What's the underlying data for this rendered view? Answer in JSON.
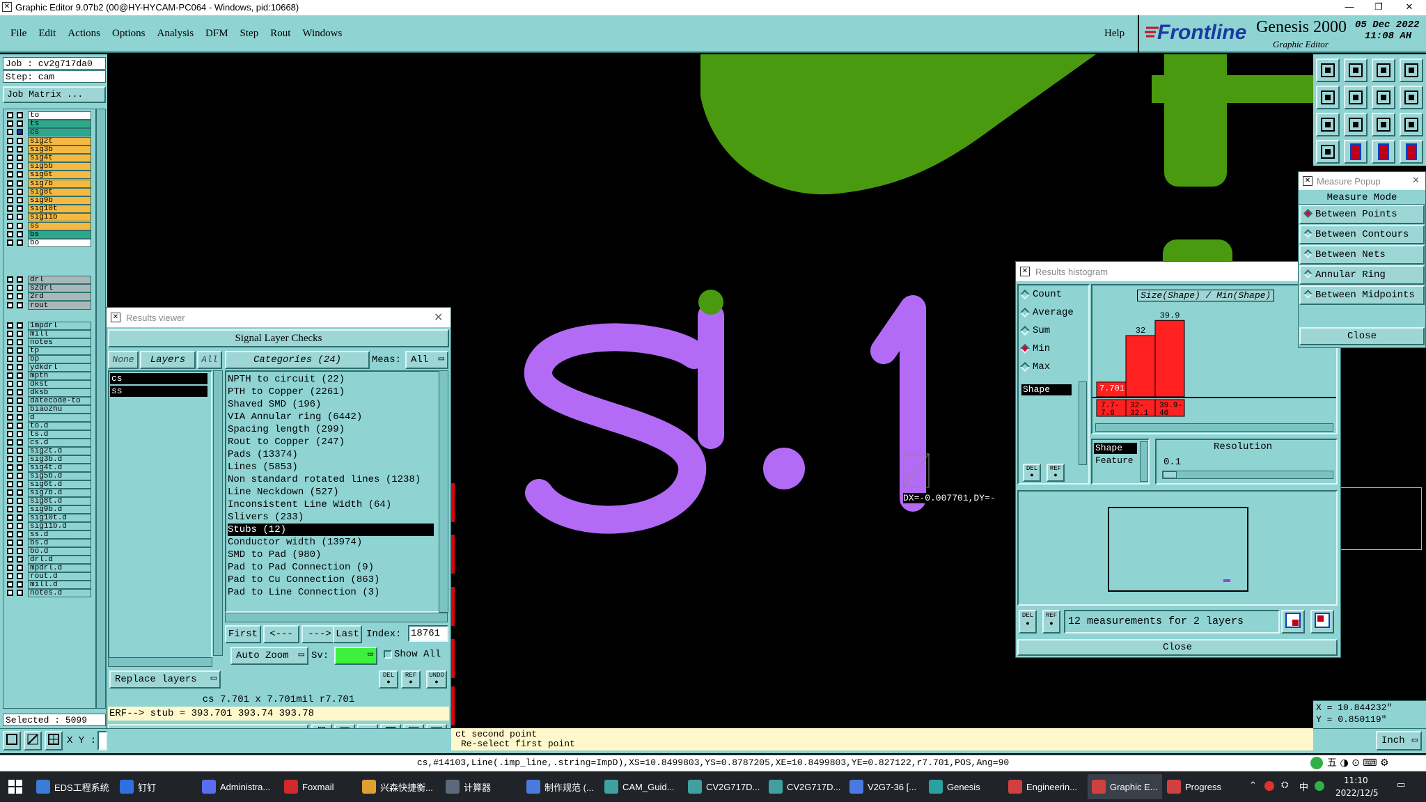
{
  "window": {
    "title": "Graphic Editor 9.07b2 (00@HY-HYCAM-PC064 - Windows, pid:10668)"
  },
  "menu": [
    "File",
    "Edit",
    "Actions",
    "Options",
    "Analysis",
    "DFM",
    "Step",
    "Rout",
    "Windows"
  ],
  "help": "Help",
  "brand": {
    "logo": "Frontline",
    "product": "Genesis 2000",
    "sub": "Graphic Editor",
    "date": "05 Dec 2022",
    "time": "11:08 AH"
  },
  "job": {
    "job": "Job : cv2g717da0",
    "step": "Step: cam",
    "matrix": "Job Matrix ..."
  },
  "layers_top": [
    {
      "name": "to",
      "color": "#ffffff"
    },
    {
      "name": "ts",
      "color": "#2ea88a"
    },
    {
      "name": "cs",
      "color": "#2ea88a",
      "active": true
    },
    {
      "name": "sig2t",
      "color": "#f5b942"
    },
    {
      "name": "sig3b",
      "color": "#f5b942"
    },
    {
      "name": "sig4t",
      "color": "#f5b942"
    },
    {
      "name": "sig5b",
      "color": "#f5b942"
    },
    {
      "name": "sig6t",
      "color": "#f5b942"
    },
    {
      "name": "sig7b",
      "color": "#f5b942"
    },
    {
      "name": "sig8t",
      "color": "#f5b942"
    },
    {
      "name": "sig9b",
      "color": "#f5b942"
    },
    {
      "name": "sig10t",
      "color": "#f5b942"
    },
    {
      "name": "sig11b",
      "color": "#f5b942"
    },
    {
      "name": "ss",
      "color": "#f5b942"
    },
    {
      "name": "bs",
      "color": "#2ea88a"
    },
    {
      "name": "bo",
      "color": "#ffffff"
    }
  ],
  "layers_drill": [
    "drl",
    "szdrl",
    "2rd",
    "rout"
  ],
  "layers_misc": [
    "1mpdrl",
    "mill",
    "notes",
    "tp",
    "bp",
    "ydkdrl",
    "mpth",
    "dkst",
    "dksb",
    "datecode-to",
    "biaozhu",
    "d",
    "to.d",
    "ts.d",
    "cs.d",
    "sig2t.d",
    "sig3b.d",
    "sig4t.d",
    "sig5b.d",
    "sig6t.d",
    "sig7b.d",
    "sig8t.d",
    "sig9b.d",
    "sig10t.d",
    "sig11b.d",
    "ss.d",
    "bs.d",
    "bo.d",
    "drl.d",
    "mpdrl.d",
    "rout.d",
    "mill.d",
    "notes.d"
  ],
  "selected": "Selected : 5099",
  "xy_label": "X Y :",
  "results_viewer": {
    "title": "Results viewer",
    "header": "Signal Layer Checks",
    "none": "None",
    "layers": "Layers",
    "all": "All",
    "categories": "Categories (24)",
    "meas_label": "Meas:",
    "meas_value": "All",
    "layer_list": [
      "cs",
      "ss"
    ],
    "items": [
      "NPTH to circuit (22)",
      "PTH to Copper (2261)",
      "Shaved SMD (196)",
      "VIA Annular ring (6442)",
      "Spacing length (299)",
      "Rout to Copper (247)",
      "Pads (13374)",
      "Lines (5853)",
      "Non standard rotated lines (1238)",
      "Line Neckdown (527)",
      "Inconsistent Line Width (64)",
      "Slivers (233)",
      "Stubs (12)",
      "Conductor width (13974)",
      "SMD to Pad (980)",
      "Pad to Pad Connection (9)",
      "Pad to Cu Connection (863)",
      "Pad to Line Connection (3)"
    ],
    "selected_index": 12,
    "first": "First",
    "prev": "<---",
    "next": "--->",
    "last": "Last",
    "index_label": "Index:",
    "index_value": "18761",
    "replace": "Replace layers",
    "auto_zoom": "Auto Zoom",
    "sv": "Sv:",
    "show_all": "Show All",
    "info": "cs 7.701 x 7.701mil  r7.701",
    "erf": "ERF--> stub = 393.701 393.74 393.78",
    "close": "Close"
  },
  "canvas": {
    "measure": "DX=-0.007701,DY=-",
    "coord_x": "X = 10.844232\"",
    "coord_y": "Y = 0.850119\""
  },
  "histogram": {
    "title": "Results histogram",
    "options": [
      "Count",
      "Average",
      "Sum",
      "Min",
      "Max"
    ],
    "selected": "Min",
    "shape": "Shape",
    "chart_title": "Size(Shape) / Min(Shape)",
    "shape2": "Shape",
    "feature": "Feature",
    "resolution": "Resolution",
    "res_value": "0.1",
    "summary": "12 measurements for 2 layers",
    "close": "Close",
    "del": "DEL",
    "ref": "REF"
  },
  "chart_data": {
    "type": "bar",
    "title": "Size(Shape) / Min(Shape)",
    "categories": [
      "7.7-7.8",
      "32-32.1",
      "39.9-40"
    ],
    "category_labels": [
      [
        "7.7-",
        "7.8"
      ],
      [
        "32-",
        "32.1"
      ],
      [
        "39.9-",
        "40"
      ]
    ],
    "values": [
      7.701,
      32,
      39.9
    ],
    "value_labels": [
      "7.701",
      "32",
      "39.9"
    ],
    "bar_color": "#ff2020",
    "ylim": [
      0,
      40
    ]
  },
  "measure": {
    "title": "Measure Popup",
    "mode": "Measure Mode",
    "options": [
      "Between Points",
      "Between Contours",
      "Between Nets",
      "Annular Ring",
      "Between Midpoints"
    ],
    "selected": "Between Points",
    "close": "Close"
  },
  "prompt": {
    "line1": "ct second point",
    "line2": "Re-select first point"
  },
  "units": "Inch",
  "status": "cs,#14103,Line(.imp_line,.string=ImpD),XS=10.8499803,YS=0.8787205,XE=10.8499803,YE=0.827122,r7.701,POS,Ang=90",
  "taskbar": {
    "items": [
      "EDS工程系统",
      "钉钉",
      "Administra...",
      "Foxmail",
      "兴森快捷衡...",
      "计算器",
      "制作规范 (...",
      "CAM_Guid...",
      "CV2G717D...",
      "CV2G717D...",
      "V2G7-36 [...",
      "Genesis",
      "Engineerin...",
      "Graphic E...",
      "Progress"
    ],
    "ime": "中",
    "clock_time": "11:10",
    "clock_date": "2022/12/5"
  }
}
